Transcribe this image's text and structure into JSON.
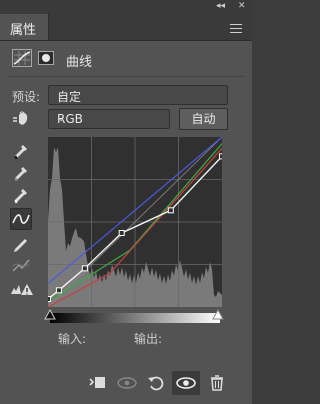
{
  "panel": {
    "tab_title": "属性",
    "menu_icon": "hamburger-menu-icon"
  },
  "header": {
    "curves_icon": "curves-adjustment-icon",
    "mask_icon": "layer-mask-icon",
    "title": "曲线"
  },
  "preset": {
    "label": "预设:",
    "value": "自定"
  },
  "channel": {
    "value": "RGB",
    "auto_label": "自动"
  },
  "tools": [
    "on-image-adjust-icon",
    "sample-black-eyedropper-icon",
    "sample-gray-eyedropper-icon",
    "sample-white-eyedropper-icon",
    "edit-points-curve-icon",
    "draw-curve-pencil-icon",
    "smooth-curve-icon",
    "clipping-warning-icon"
  ],
  "io": {
    "input_label": "输入:",
    "output_label": "输出:"
  },
  "curve": {
    "rgb_points": [
      [
        0,
        12
      ],
      [
        16,
        25
      ],
      [
        54,
        58
      ],
      [
        108,
        111
      ],
      [
        180,
        145
      ],
      [
        255,
        226
      ]
    ],
    "colors": {
      "rgb": "#f2f2f2",
      "red": "#c84040",
      "green": "#3fa83f",
      "blue": "#4a5ae0"
    }
  },
  "footer_icons": [
    "clip-to-layer-icon",
    "view-previous-state-icon",
    "reset-adjustment-icon",
    "toggle-visibility-icon",
    "delete-adjustment-icon"
  ]
}
